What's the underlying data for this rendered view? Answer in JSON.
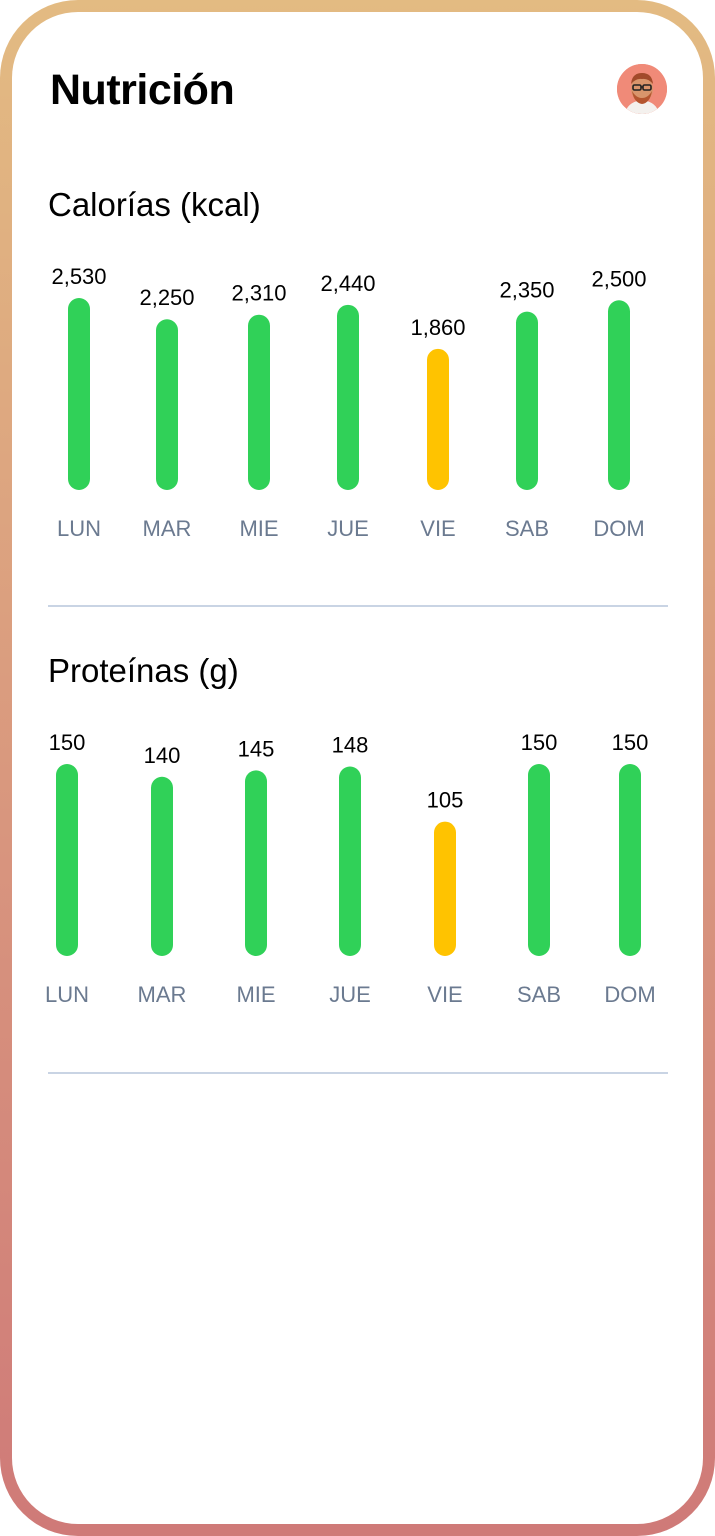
{
  "header": {
    "title": "Nutrición",
    "avatar_icon": "user-avatar-icon"
  },
  "colors": {
    "on_target": "#30d158",
    "below_target": "#ffc300",
    "day_label": "#6b7a90",
    "value_label": "#000000",
    "divider": "#c9d4e4"
  },
  "chart_data": [
    {
      "type": "bar",
      "title": "Calorías (kcal)",
      "categories": [
        "LUN",
        "MAR",
        "MIE",
        "JUE",
        "VIE",
        "SAB",
        "DOM"
      ],
      "values": [
        2530,
        2250,
        2310,
        2440,
        1860,
        2350,
        2500
      ],
      "value_labels": [
        "2,530",
        "2,250",
        "2,310",
        "2,440",
        "1,860",
        "2,350",
        "2,500"
      ],
      "status": [
        "ok",
        "ok",
        "ok",
        "ok",
        "low",
        "ok",
        "ok"
      ],
      "ylim": [
        0,
        2530
      ],
      "grid": false,
      "xlabel": "",
      "ylabel": ""
    },
    {
      "type": "bar",
      "title": "Proteínas (g)",
      "categories": [
        "LUN",
        "MAR",
        "MIE",
        "JUE",
        "VIE",
        "SAB",
        "DOM"
      ],
      "values": [
        150,
        140,
        145,
        148,
        105,
        150,
        150
      ],
      "value_labels": [
        "150",
        "140",
        "145",
        "148",
        "105",
        "150",
        "150"
      ],
      "status": [
        "ok",
        "ok",
        "ok",
        "ok",
        "low",
        "ok",
        "ok"
      ],
      "ylim": [
        0,
        150
      ],
      "grid": false,
      "xlabel": "",
      "ylabel": ""
    }
  ]
}
